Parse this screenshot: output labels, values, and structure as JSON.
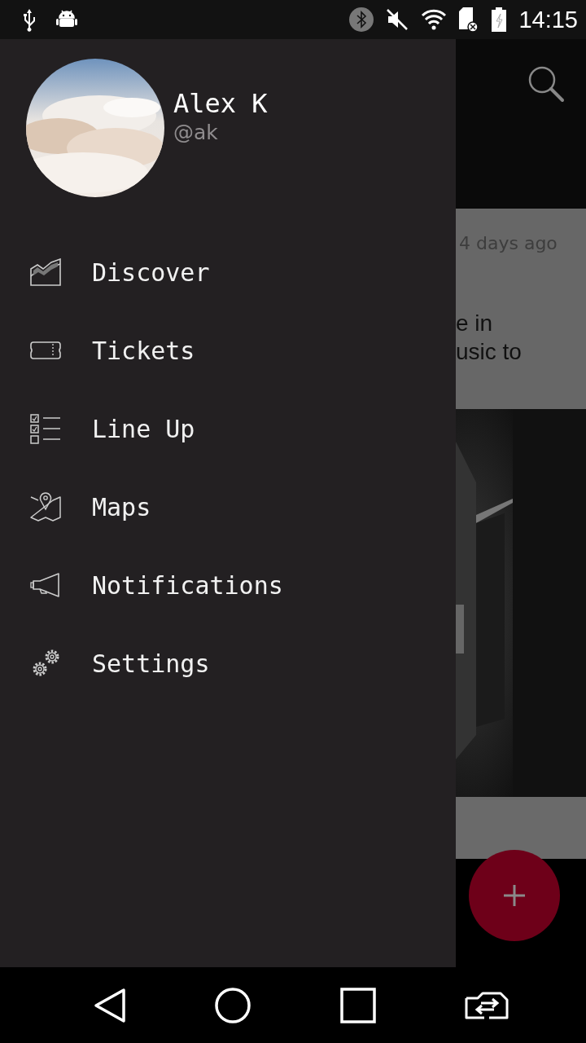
{
  "status_bar": {
    "time": "14:15"
  },
  "drawer": {
    "user": {
      "name": "Alex K",
      "handle": "@ak"
    },
    "items": [
      {
        "label": "Discover"
      },
      {
        "label": "Tickets"
      },
      {
        "label": "Line Up"
      },
      {
        "label": "Maps"
      },
      {
        "label": "Notifications"
      },
      {
        "label": "Settings"
      }
    ]
  },
  "background": {
    "card": {
      "time": "4 days ago",
      "lines": [
        "e in",
        "usic to"
      ]
    }
  }
}
